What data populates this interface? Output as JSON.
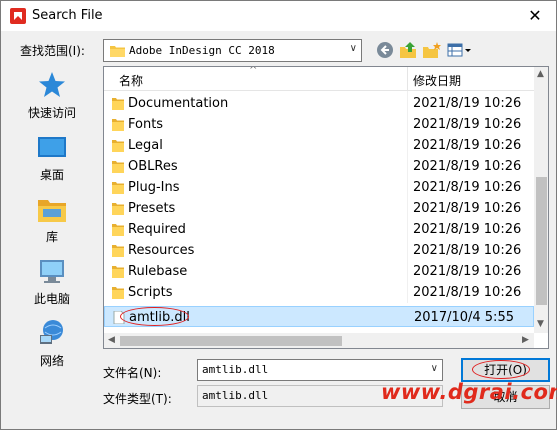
{
  "window": {
    "title": "Search File",
    "close_glyph": "✕"
  },
  "toolbar": {
    "lookin_label": "查找范围(I):",
    "lookin_value": "Adobe InDesign CC 2018",
    "icons": [
      "back-icon",
      "up-folder-icon",
      "new-folder-icon",
      "view-menu-icon"
    ]
  },
  "places": [
    {
      "label": "快速访问",
      "icon": "quick-access-icon"
    },
    {
      "label": "桌面",
      "icon": "desktop-icon"
    },
    {
      "label": "库",
      "icon": "libraries-icon"
    },
    {
      "label": "此电脑",
      "icon": "this-pc-icon"
    },
    {
      "label": "网络",
      "icon": "network-icon"
    }
  ],
  "filelist": {
    "columns": {
      "name": "名称",
      "date": "修改日期"
    },
    "rows": [
      {
        "name": "Documentation",
        "date": "2021/8/19 10:26",
        "type": "folder"
      },
      {
        "name": "Fonts",
        "date": "2021/8/19 10:26",
        "type": "folder"
      },
      {
        "name": "Legal",
        "date": "2021/8/19 10:26",
        "type": "folder"
      },
      {
        "name": "OBLRes",
        "date": "2021/8/19 10:26",
        "type": "folder"
      },
      {
        "name": "Plug-Ins",
        "date": "2021/8/19 10:26",
        "type": "folder"
      },
      {
        "name": "Presets",
        "date": "2021/8/19 10:26",
        "type": "folder"
      },
      {
        "name": "Required",
        "date": "2021/8/19 10:26",
        "type": "folder"
      },
      {
        "name": "Resources",
        "date": "2021/8/19 10:26",
        "type": "folder"
      },
      {
        "name": "Rulebase",
        "date": "2021/8/19 10:26",
        "type": "folder"
      },
      {
        "name": "Scripts",
        "date": "2021/8/19 10:26",
        "type": "folder"
      },
      {
        "name": "amtlib.dll",
        "date": "2017/10/4 5:55",
        "type": "file",
        "selected": true
      }
    ]
  },
  "form": {
    "filename_label": "文件名(N):",
    "filename_value": "amtlib.dll",
    "filetype_label": "文件类型(T):",
    "filetype_value": "amtlib.dll",
    "open_label": "打开(O)",
    "cancel_label": "取消"
  },
  "watermark": "www.dgrai.com",
  "colors": {
    "accent": "#0078d7",
    "selection": "#cce8ff",
    "annotation": "#e02020",
    "folder": "#f5c542"
  }
}
